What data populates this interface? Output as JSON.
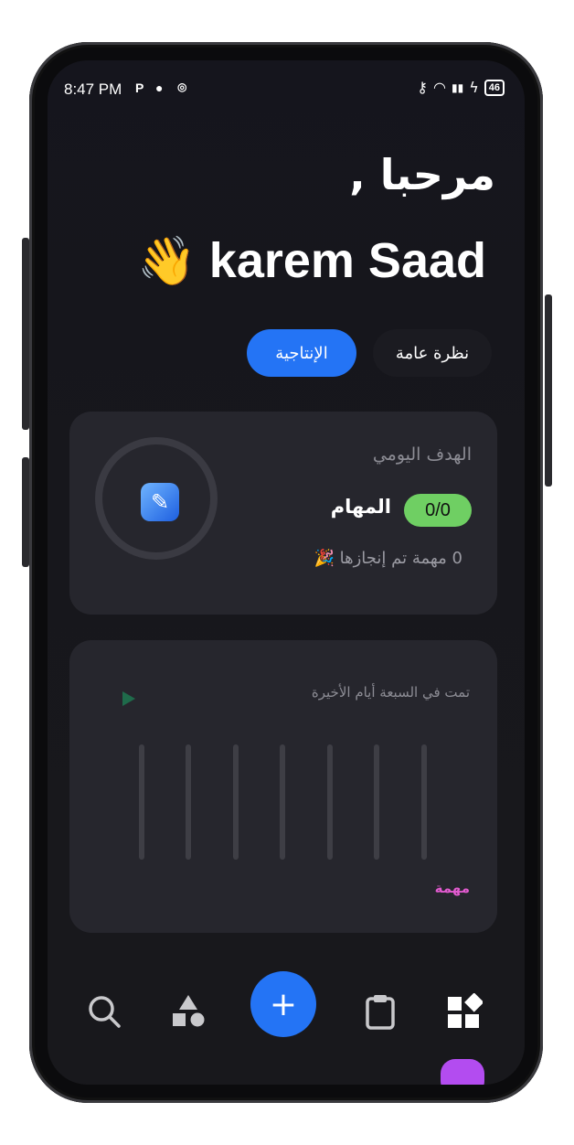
{
  "status_bar": {
    "time": "8:47 PM",
    "battery": "46"
  },
  "greeting": {
    "line1": "مرحبا ,",
    "name": "karem Saad",
    "emoji": "👋"
  },
  "tabs": [
    {
      "label": "الإنتاجية",
      "active": true
    },
    {
      "label": "نظرة عامة",
      "active": false
    }
  ],
  "daily_card": {
    "title": "الهدف اليومي",
    "tasks_label": "المهام",
    "progress": "0/0",
    "completed_text": "0 مهمة  تم إنجازها 🎉"
  },
  "week_card": {
    "title": "تمت في السبعة أيام الأخيرة",
    "bars": [
      0,
      0,
      0,
      0,
      0,
      0,
      0
    ],
    "legend": "مهمة"
  },
  "nav": {
    "add_label": "+"
  },
  "colors": {
    "accent": "#2474f5",
    "progress_pill": "#6fcf63",
    "legend": "#e35bd0"
  }
}
